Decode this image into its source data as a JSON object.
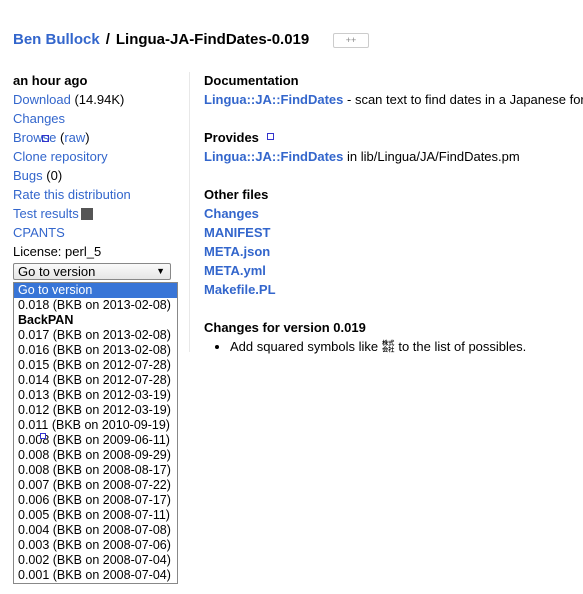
{
  "header": {
    "author": "Ben Bullock",
    "separator": "/",
    "distribution": "Lingua-JA-FindDates-0.019",
    "plusone_label": "++"
  },
  "sidebar": {
    "released": "an hour ago",
    "download_label": "Download",
    "download_size": "(14.94K)",
    "changes": "Changes",
    "browse": "Browse",
    "raw": "raw",
    "clone": "Clone repository",
    "bugs": "Bugs",
    "bugs_count": "(0)",
    "rate": "Rate this distribution",
    "test_results": "Test results",
    "cpants": "CPANTS",
    "license": "License: perl_5"
  },
  "version_select": {
    "selected": "Go to version",
    "options": [
      {
        "label": "Go to version",
        "selected": true
      },
      {
        "label": "0.018 (BKB on 2013-02-08)"
      },
      {
        "label": "BackPAN",
        "group": true
      },
      {
        "label": "0.017 (BKB on 2013-02-08)"
      },
      {
        "label": "0.016 (BKB on 2013-02-08)"
      },
      {
        "label": "0.015 (BKB on 2012-07-28)"
      },
      {
        "label": "0.014 (BKB on 2012-07-28)"
      },
      {
        "label": "0.013 (BKB on 2012-03-19)"
      },
      {
        "label": "0.012 (BKB on 2012-03-19)"
      },
      {
        "label": "0.011 (BKB on 2010-09-19)"
      },
      {
        "label": "0.008 (BKB on 2009-06-11)"
      },
      {
        "label": "0.008 (BKB on 2008-09-29)"
      },
      {
        "label": "0.008 (BKB on 2008-08-17)"
      },
      {
        "label": "0.007 (BKB on 2008-07-22)"
      },
      {
        "label": "0.006 (BKB on 2008-07-17)"
      },
      {
        "label": "0.005 (BKB on 2008-07-11)"
      },
      {
        "label": "0.004 (BKB on 2008-07-08)"
      },
      {
        "label": "0.003 (BKB on 2008-07-06)"
      },
      {
        "label": "0.002 (BKB on 2008-07-04)"
      },
      {
        "label": "0.001 (BKB on 2008-07-04)"
      }
    ]
  },
  "main": {
    "documentation_heading": "Documentation",
    "doc_module": "Lingua::JA::FindDates",
    "doc_desc": " - scan text to find dates in a Japanese format",
    "provides_heading": "Provides",
    "provides_module": "Lingua::JA::FindDates",
    "provides_path": " in lib/Lingua/JA/FindDates.pm",
    "other_files_heading": "Other files",
    "files": [
      "Changes",
      "MANIFEST",
      "META.json",
      "META.yml",
      "Makefile.PL"
    ],
    "changes_heading": "Changes for version 0.019",
    "changes_items": [
      "Add squared symbols like ㍿ to the list of possibles."
    ]
  }
}
